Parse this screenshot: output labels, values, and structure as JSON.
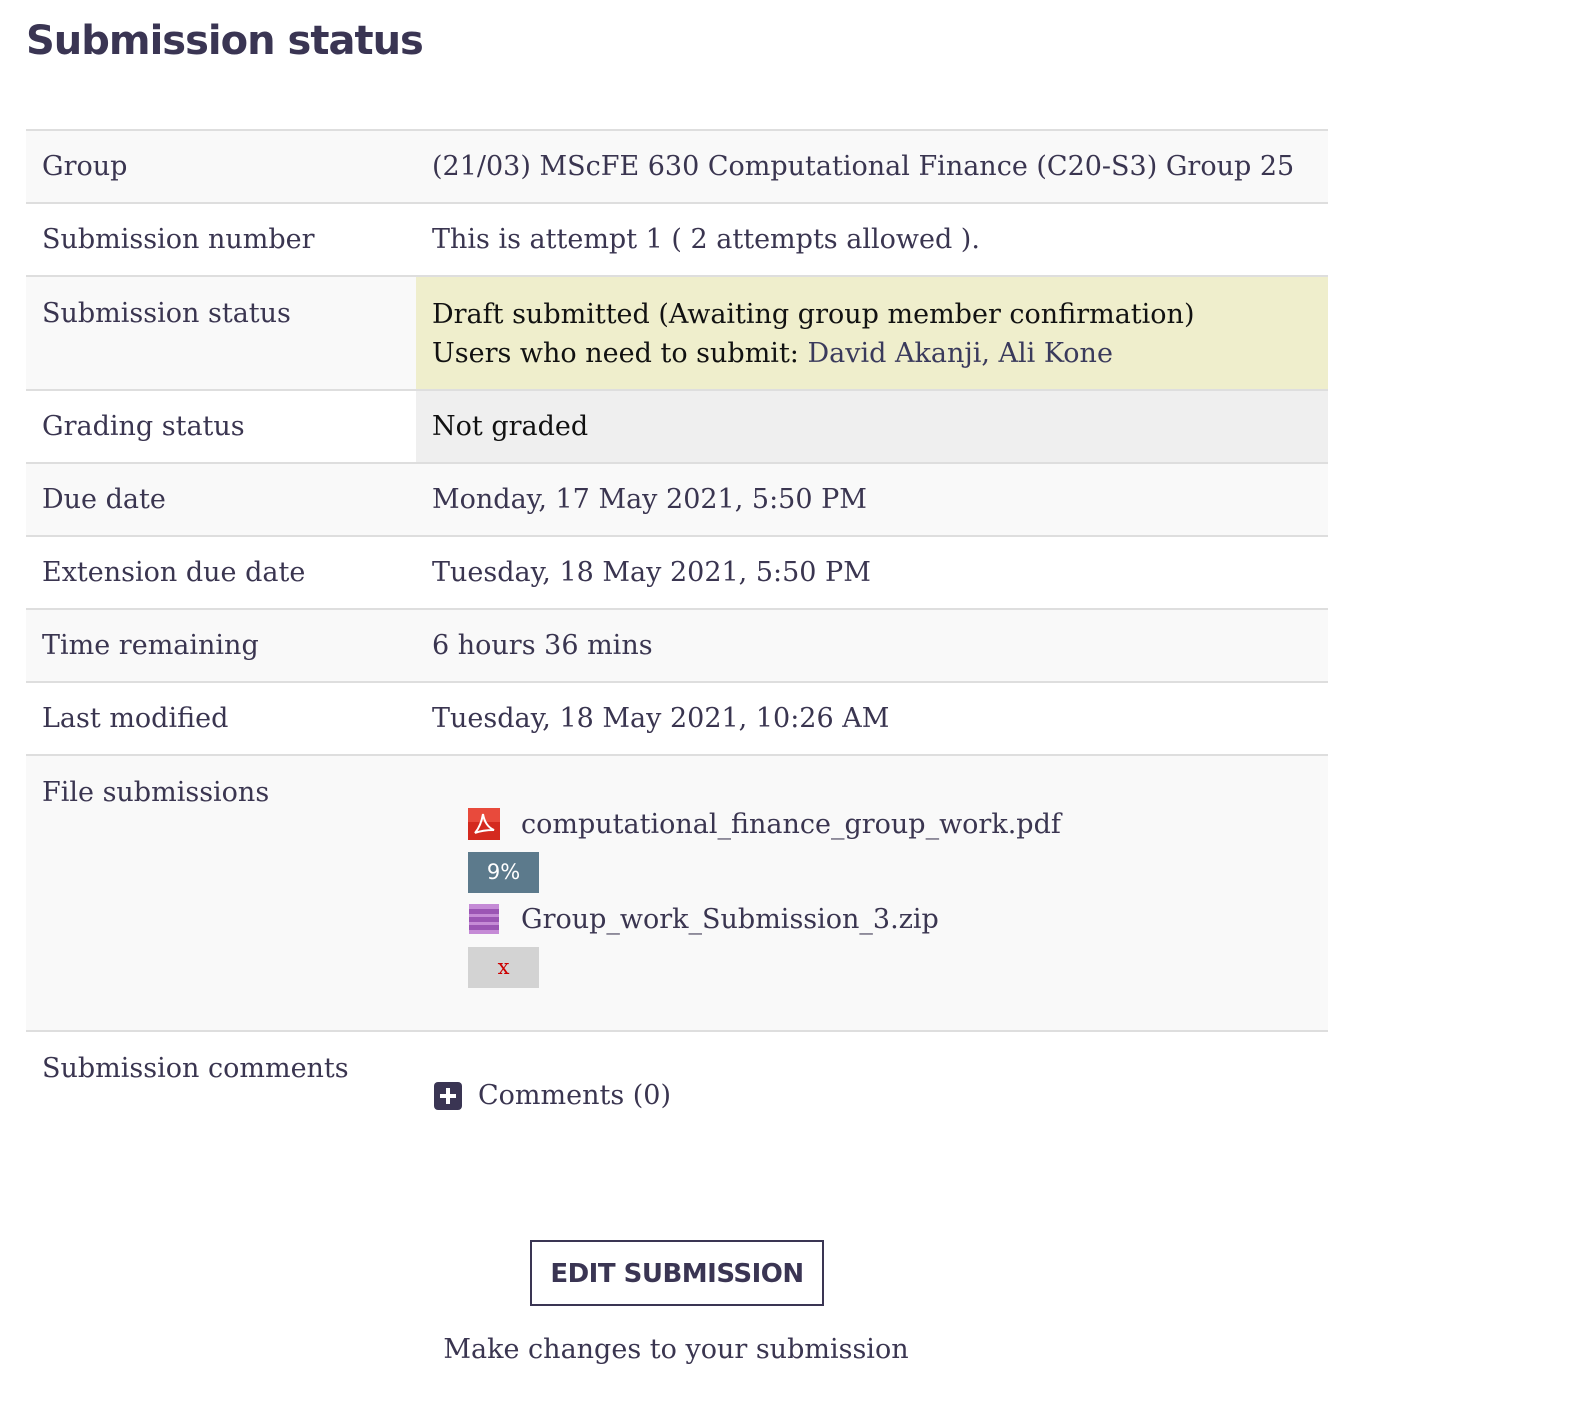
{
  "page": {
    "title": "Submission status"
  },
  "rows": {
    "group": {
      "label": "Group",
      "value": "(21/03) MScFE 630 Computational Finance (C20-S3) Group 25"
    },
    "submission_number": {
      "label": "Submission number",
      "value": "This is attempt 1 ( 2 attempts allowed )."
    },
    "submission_status": {
      "label": "Submission status",
      "value": "Draft submitted (Awaiting group member confirmation)",
      "users_prefix": "Users who need to submit:",
      "users": "David Akanji, Ali Kone"
    },
    "grading_status": {
      "label": "Grading status",
      "value": "Not graded"
    },
    "due_date": {
      "label": "Due date",
      "value": "Monday, 17 May 2021, 5:50 PM"
    },
    "extension_due_date": {
      "label": "Extension due date",
      "value": "Tuesday, 18 May 2021, 5:50 PM"
    },
    "time_remaining": {
      "label": "Time remaining",
      "value": "6 hours 36 mins"
    },
    "last_modified": {
      "label": "Last modified",
      "value": "Tuesday, 18 May 2021, 10:26 AM"
    },
    "file_submissions": {
      "label": "File submissions",
      "files": [
        {
          "name": "computational_finance_group_work.pdf",
          "icon": "pdf-icon",
          "badge": "9%"
        },
        {
          "name": "Group_work_Submission_3.zip",
          "icon": "archive-icon",
          "badge": "x"
        }
      ]
    },
    "submission_comments": {
      "label": "Submission comments",
      "link": "Comments (0)"
    }
  },
  "actions": {
    "edit_label": "EDIT SUBMISSION",
    "edit_help": "Make changes to your submission"
  },
  "colors": {
    "heading": "#3a3553",
    "status_highlight": "#efeecc",
    "grading_bg": "#efefef",
    "score_badge": "#5c7a8c",
    "error_badge": "#d3d3d3",
    "error_text": "#cc0000"
  }
}
